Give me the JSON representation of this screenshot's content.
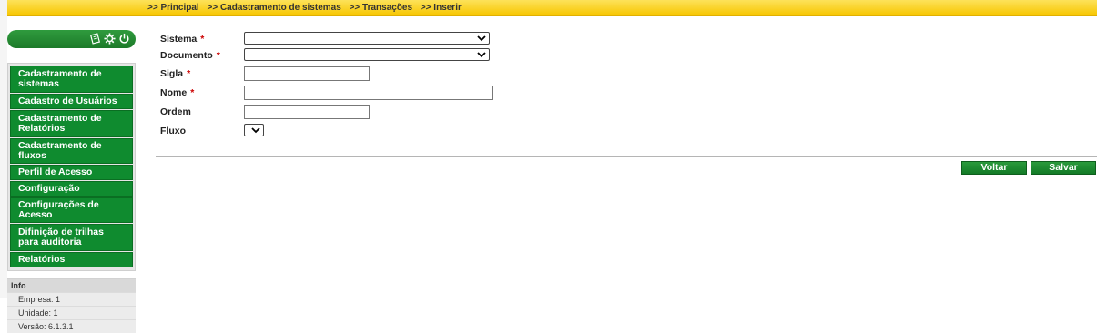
{
  "breadcrumb": [
    ">> Principal",
    ">> Cadastramento de sistemas",
    ">> Transações",
    ">> Inserir"
  ],
  "sidebar": {
    "icons": [
      "notepad-icon",
      "gear-icon",
      "power-icon"
    ],
    "items": [
      {
        "label": "Cadastramento de sistemas"
      },
      {
        "label": "Cadastro de Usuários"
      },
      {
        "label": "Cadastramento de Relatórios"
      },
      {
        "label": "Cadastramento de fluxos"
      },
      {
        "label": "Perfil de Acesso"
      },
      {
        "label": "Configuração"
      },
      {
        "label": "Configurações de Acesso"
      },
      {
        "label": "Difinição de trilhas para auditoria"
      },
      {
        "label": "Relatórios"
      }
    ]
  },
  "info": {
    "title": "Info",
    "empresa": "Empresa: 1",
    "unidade": "Unidade: 1",
    "versao": "Versão: 6.1.3.1"
  },
  "form": {
    "sistema_label": "Sistema",
    "documento_label": "Documento",
    "sigla_label": "Sigla",
    "nome_label": "Nome",
    "ordem_label": "Ordem",
    "fluxo_label": "Fluxo",
    "required_mark": "*",
    "sistema_value": "",
    "documento_value": "",
    "sigla_value": "",
    "nome_value": "",
    "ordem_value": "",
    "fluxo_value": ""
  },
  "buttons": {
    "voltar": "Voltar",
    "salvar": "Salvar"
  },
  "colors": {
    "accent_green": "#0f8b2f",
    "topbar_yellow": "#f7c600",
    "required_red": "#cc0000"
  }
}
